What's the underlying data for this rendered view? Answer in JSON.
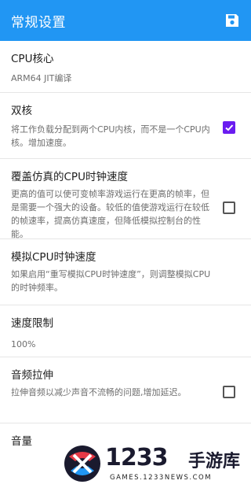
{
  "appbar": {
    "title": "常规设置",
    "save_icon": "save-icon",
    "color": "#2196f3"
  },
  "settings": [
    {
      "title": "CPU核心",
      "subtitle": "ARM64 JIT编译"
    },
    {
      "title": "双核",
      "subtitle": "将工作负载分配到两个CPU内核，而不是一个CPU内核。增加速度。",
      "checked": true
    },
    {
      "title": "覆盖仿真的CPU时钟速度",
      "subtitle": "更高的值可以使可变帧率游戏运行在更高的帧率，但是需要一个强大的设备。较低的值使游戏运行在较低的帧速率，提高仿真速度，但降低模拟控制台的性能。",
      "checked": false
    },
    {
      "title": "模拟CPU时钟速度",
      "subtitle": "如果启用“重写模拟CPU时钟速度”，则调整模拟CPU的时钟频率。"
    },
    {
      "title": "速度限制",
      "subtitle": "100%"
    },
    {
      "title": "音频拉伸",
      "subtitle": "拉伸音频以减少声音不流畅的问题,增加延迟。",
      "checked": false
    },
    {
      "title": "音量"
    }
  ],
  "checkbox_color": "#6a1cf0",
  "watermark": {
    "number": "1233",
    "name": "手游库",
    "url": "GAMES.1233NEWS.COM"
  }
}
